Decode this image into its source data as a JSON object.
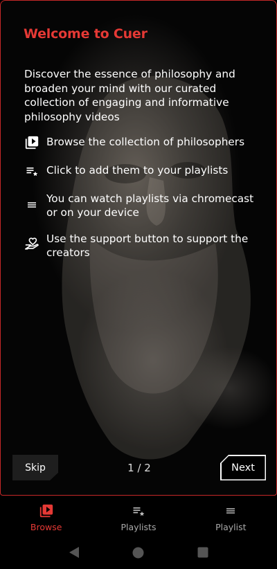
{
  "onboarding": {
    "title": "Welcome to Cuer",
    "intro": "Discover the essence of philosophy and broaden your mind with our curated collection of engaging and informative philosophy videos",
    "features": [
      {
        "icon": "video-library-icon",
        "text": "Browse the collection of philosophers"
      },
      {
        "icon": "playlist-add-icon",
        "text": "Click to add them to your playlists"
      },
      {
        "icon": "list-icon",
        "text": "You can watch playlists via chromecast or on your device"
      },
      {
        "icon": "support-hand-heart-icon",
        "text": "Use the support button to support the creators"
      }
    ],
    "skip_label": "Skip",
    "page_indicator": "1 / 2",
    "next_label": "Next",
    "accent_color": "#e53935"
  },
  "bottom_nav": {
    "items": [
      {
        "label": "Browse",
        "icon": "video-library-icon",
        "active": true
      },
      {
        "label": "Playlists",
        "icon": "playlist-star-icon",
        "active": false
      },
      {
        "label": "Playlist",
        "icon": "list-icon",
        "active": false
      }
    ]
  },
  "system_nav": {
    "buttons": [
      "back-triangle-icon",
      "home-circle-icon",
      "recents-square-icon"
    ]
  }
}
